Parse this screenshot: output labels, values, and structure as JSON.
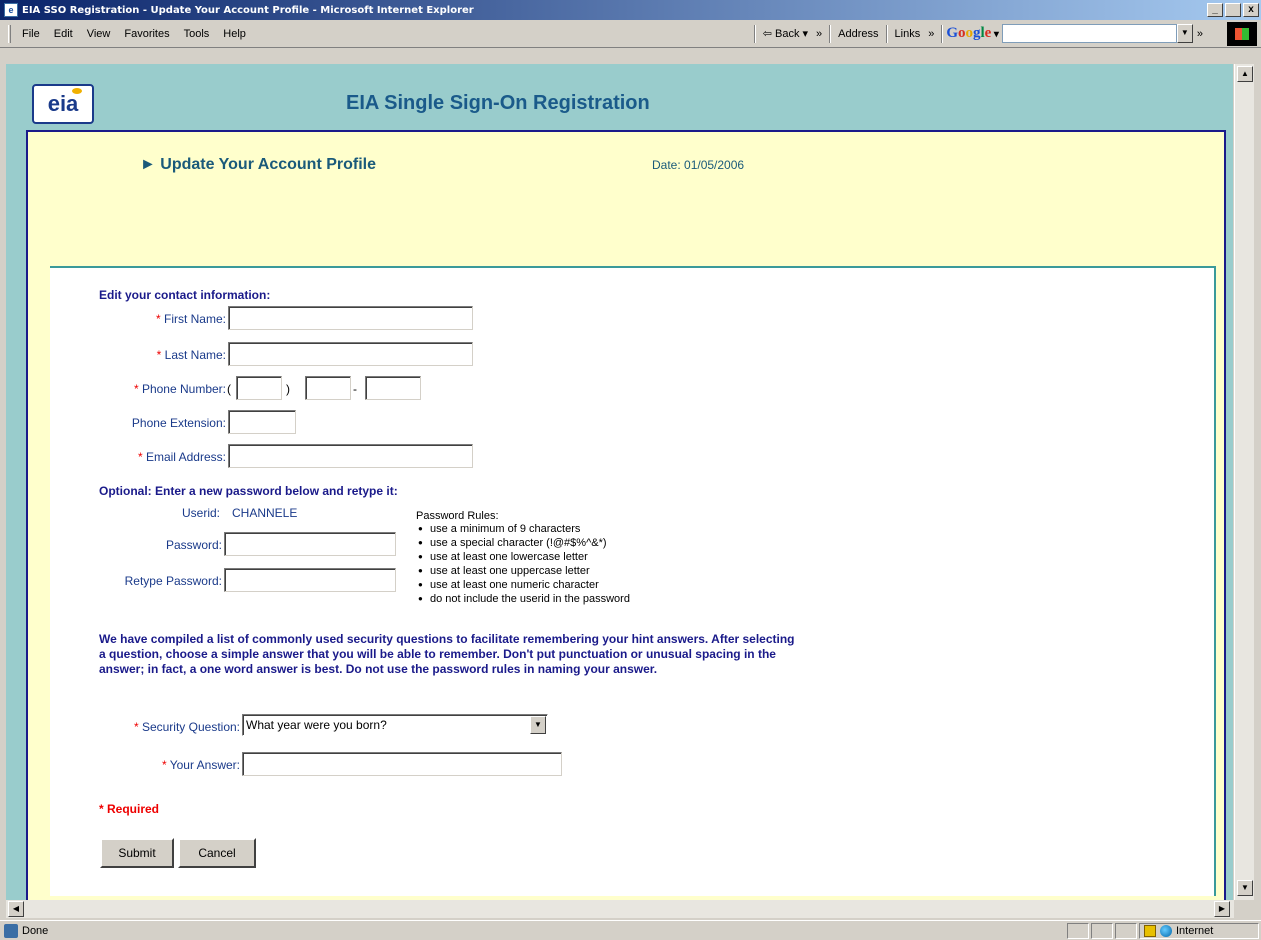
{
  "window": {
    "title": "EIA SSO Registration - Update Your Account Profile - Microsoft Internet Explorer",
    "minimize": "_",
    "maximize": " ",
    "close": "x"
  },
  "menu": [
    "File",
    "Edit",
    "View",
    "Favorites",
    "Tools",
    "Help"
  ],
  "toolbar": {
    "back_label": "⇦ Back ▾",
    "chevron": "»",
    "address_label": "Address",
    "links_label": "Links"
  },
  "page": {
    "logo_text": "eia",
    "site_title": "EIA Single Sign-On Registration",
    "subtitle": "► Update Your Account Profile",
    "date": "Date: 01/05/2006",
    "contact_heading": "Edit your contact information:",
    "first_name_label": "First Name:",
    "last_name_label": "Last Name:",
    "phone_label": "Phone Number:",
    "phone_open": "(",
    "phone_close": ")",
    "phone_dash": "-",
    "ext_label": "Phone Extension:",
    "email_label": "Email Address:",
    "required_star": "*",
    "password_heading": "Optional: Enter a new password below and retype it:",
    "userid_label": "Userid:",
    "userid_value": "CHANNELE",
    "password_label": "Password:",
    "retype_label": "Retype Password:",
    "rules_title": "Password Rules:",
    "rules": [
      "use a minimum of 9 characters",
      "use a special character (!@#$%^&*)",
      "use at least one lowercase letter",
      "use at least one uppercase letter",
      "use at least one numeric character",
      "do not include the userid in the password"
    ],
    "security_info": "We have compiled a list of commonly used security questions to facilitate remembering your hint answers. After selecting a question, choose a simple answer that you will be able to remember. Don't put punctuation or unusual spacing in the answer; in fact, a one word answer is best. Do not use the password rules in naming your answer.",
    "security_question_label": "Security Question:",
    "security_question_value": "What year were you born?",
    "answer_label": "Your Answer:",
    "required_note": "* Required",
    "submit": "Submit",
    "cancel": "Cancel"
  },
  "status": {
    "text": "Done",
    "zone": "Internet"
  }
}
